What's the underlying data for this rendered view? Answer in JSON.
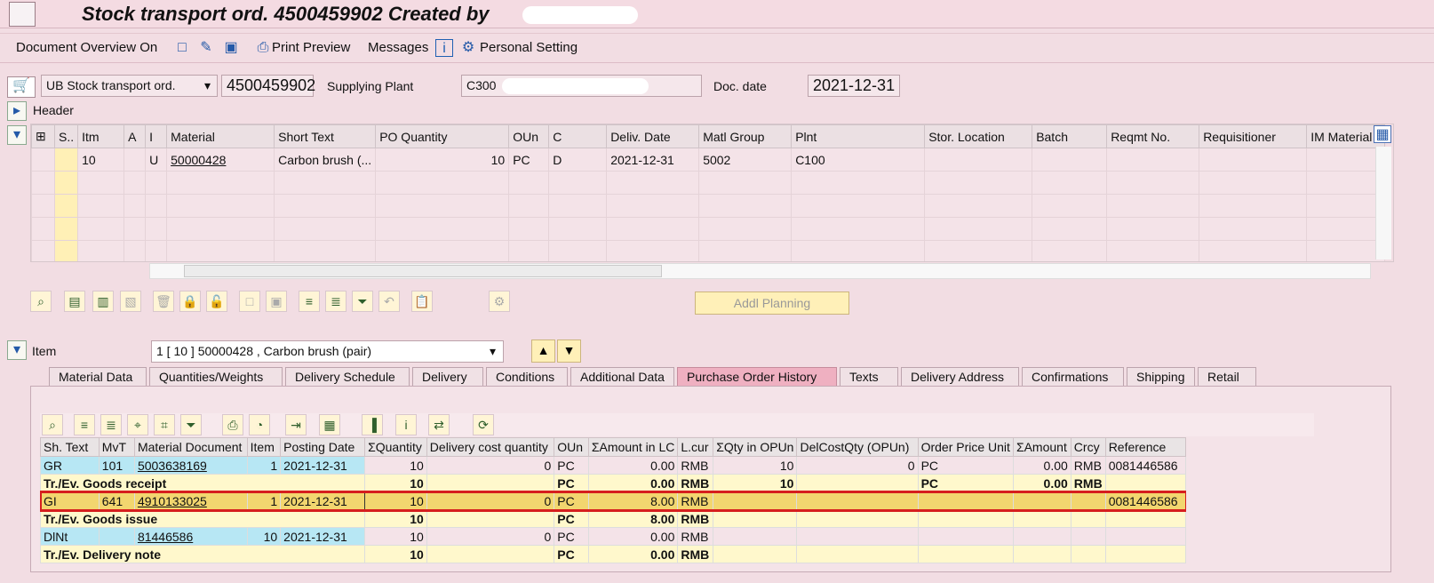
{
  "window": {
    "title": "Stock transport ord. 4500459902 Created by"
  },
  "toolbar": {
    "doc_overview": "Document Overview On",
    "print_preview": "Print Preview",
    "messages": "Messages",
    "personal_setting": "Personal Setting"
  },
  "header": {
    "doc_type": "UB Stock transport ord.",
    "po_number": "4500459902",
    "supplying_plant_label": "Supplying Plant",
    "supplying_plant_value": "C300",
    "doc_date_label": "Doc. date",
    "doc_date_value": "2021-12-31",
    "header_label": "Header"
  },
  "items_table": {
    "columns": [
      "S..",
      "Itm",
      "A",
      "I",
      "Material",
      "Short Text",
      "PO Quantity",
      "OUn",
      "C",
      "Deliv. Date",
      "Matl Group",
      "Plnt",
      "Stor. Location",
      "Batch",
      "Reqmt No.",
      "Requisitioner",
      "IM Material"
    ],
    "rows": [
      [
        "",
        "10",
        "",
        "U",
        "50000428",
        "Carbon brush (...",
        "10",
        "PC",
        "D",
        "2021-12-31",
        "5002",
        "C100",
        "",
        "",
        "",
        "",
        ""
      ],
      [
        "",
        "",
        "",
        "",
        "",
        "",
        "",
        "",
        "",
        "",
        "",
        "",
        "",
        "",
        "",
        "",
        ""
      ],
      [
        "",
        "",
        "",
        "",
        "",
        "",
        "",
        "",
        "",
        "",
        "",
        "",
        "",
        "",
        "",
        "",
        ""
      ],
      [
        "",
        "",
        "",
        "",
        "",
        "",
        "",
        "",
        "",
        "",
        "",
        "",
        "",
        "",
        "",
        "",
        ""
      ],
      [
        "",
        "",
        "",
        "",
        "",
        "",
        "",
        "",
        "",
        "",
        "",
        "",
        "",
        "",
        "",
        "",
        ""
      ]
    ]
  },
  "action_bar": {
    "addl_planning": "Addl Planning"
  },
  "item_selector": {
    "label": "Item",
    "value": "1 [ 10 ] 50000428 , Carbon brush (pair)"
  },
  "tabs": [
    "Material Data",
    "Quantities/Weights",
    "Delivery Schedule",
    "Delivery",
    "Conditions",
    "Additional Data",
    "Purchase Order History",
    "Texts",
    "Delivery Address",
    "Confirmations",
    "Shipping",
    "Retail"
  ],
  "history_table": {
    "columns": [
      "Sh. Text",
      "MvT",
      "Material Document",
      "Item",
      "Posting Date",
      "ΣQuantity",
      "Delivery cost quantity",
      "OUn",
      "ΣAmount in LC",
      "L.cur",
      "ΣQty in OPUn",
      "DelCostQty (OPUn)",
      "Order Price Unit",
      "ΣAmount",
      "Crcy",
      "Reference"
    ],
    "rows": [
      [
        "GR",
        "101",
        "5003638169",
        "1",
        "2021-12-31",
        "10",
        "0",
        "PC",
        "0.00",
        "RMB",
        "10",
        "0",
        "PC",
        "0.00",
        "RMB",
        "0081446586"
      ],
      [
        "Tr./Ev. Goods receipt",
        "",
        "",
        "",
        "",
        "10",
        "",
        "PC",
        "0.00",
        "RMB",
        "10",
        "",
        "PC",
        "0.00",
        "RMB",
        ""
      ],
      [
        "GI",
        "641",
        "4910133025",
        "1",
        "2021-12-31",
        "10",
        "0",
        "PC",
        "8.00",
        "RMB",
        "",
        "",
        "",
        "",
        "",
        "0081446586"
      ],
      [
        "Tr./Ev. Goods issue",
        "",
        "",
        "",
        "",
        "10",
        "",
        "PC",
        "8.00",
        "RMB",
        "",
        "",
        "",
        "",
        "",
        ""
      ],
      [
        "DlNt",
        "",
        "81446586",
        "10",
        "2021-12-31",
        "10",
        "0",
        "PC",
        "0.00",
        "RMB",
        "",
        "",
        "",
        "",
        "",
        ""
      ],
      [
        "Tr./Ev. Delivery note",
        "",
        "",
        "",
        "",
        "10",
        "",
        "PC",
        "0.00",
        "RMB",
        "",
        "",
        "",
        "",
        "",
        ""
      ]
    ]
  }
}
